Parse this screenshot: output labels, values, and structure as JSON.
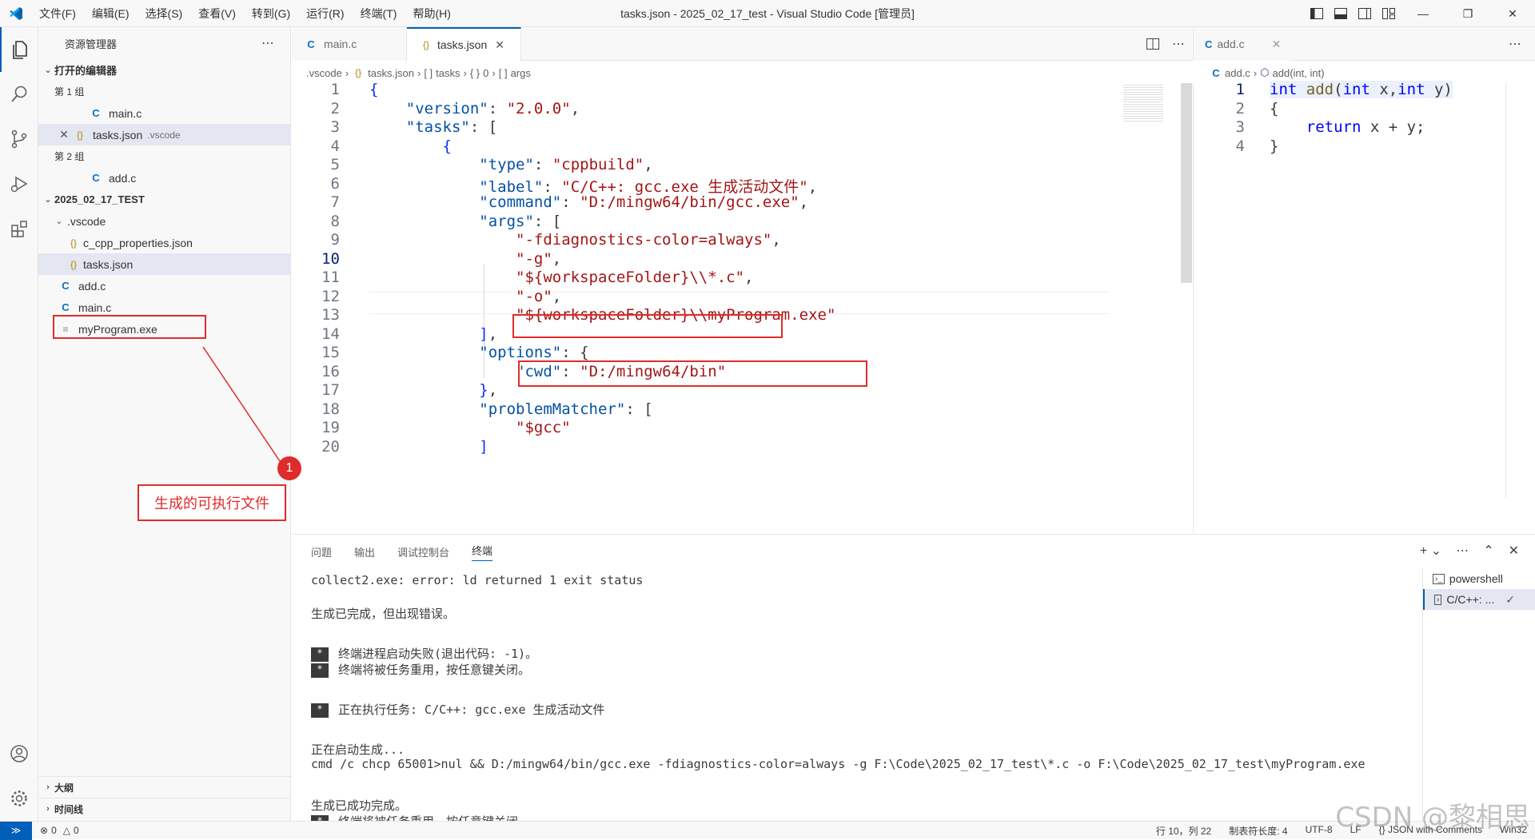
{
  "titlebar": {
    "menus": [
      "文件(F)",
      "编辑(E)",
      "选择(S)",
      "查看(V)",
      "转到(G)",
      "运行(R)",
      "终端(T)",
      "帮助(H)"
    ],
    "title": "tasks.json - 2025_02_17_test - Visual Studio Code [管理员]"
  },
  "sidebar": {
    "title": "资源管理器",
    "open_editors": "打开的编辑器",
    "group1": "第 1 组",
    "group1_files": [
      "main.c",
      "tasks.json"
    ],
    "group1_dir": ".vscode",
    "group2": "第 2 组",
    "group2_files": [
      "add.c"
    ],
    "workspace": "2025_02_17_TEST",
    "vscode_dir": ".vscode",
    "vscode_files": [
      "c_cpp_properties.json",
      "tasks.json"
    ],
    "root_files": [
      "add.c",
      "main.c",
      "myProgram.exe"
    ],
    "outline": "大纲",
    "timeline": "时间线"
  },
  "annotation": {
    "badge": "1",
    "label": "生成的可执行文件"
  },
  "editor1": {
    "tabs": [
      "main.c",
      "tasks.json"
    ],
    "crumbs": [
      ".vscode",
      "tasks.json",
      "tasks",
      "0",
      "args"
    ],
    "line_numbers": [
      "1",
      "2",
      "3",
      "4",
      "5",
      "6",
      "7",
      "8",
      "9",
      "10",
      "11",
      "12",
      "13",
      "14",
      "15",
      "16",
      "17",
      "18",
      "19",
      "20"
    ],
    "lines": [
      "{",
      "    \"version\": \"2.0.0\",",
      "    \"tasks\": [",
      "        {",
      "            \"type\": \"cppbuild\",",
      "            \"label\": \"C/C++: gcc.exe 生成活动文件\",",
      "            \"command\": \"D:/mingw64/bin/gcc.exe\",",
      "            \"args\": [",
      "                \"-fdiagnostics-color=always\",",
      "                \"-g\",",
      "                \"${workspaceFolder}\\\\*.c\",",
      "                \"-o\",",
      "                \"${workspaceFolder}\\\\myProgram.exe\"",
      "            ],",
      "            \"options\": {",
      "                \"cwd\": \"D:/mingw64/bin\"",
      "            },",
      "            \"problemMatcher\": [",
      "                \"$gcc\"",
      "            ]"
    ]
  },
  "editor2": {
    "tab": "add.c",
    "crumbs": [
      "add.c",
      "add(int, int)"
    ],
    "line_numbers": [
      "1",
      "2",
      "3",
      "4"
    ],
    "lines": [
      "int add(int x,int y)",
      "{",
      "    return x + y;",
      "}"
    ]
  },
  "panel": {
    "tabs": [
      "问题",
      "输出",
      "调试控制台",
      "终端"
    ],
    "terminal_lines": [
      "collect2.exe: error: ld returned 1 exit status",
      "",
      "生成已完成，但出现错误。",
      "",
      "终端进程启动失败(退出代码: -1)。",
      "终端将被任务重用，按任意键关闭。",
      "",
      "正在执行任务: C/C++: gcc.exe 生成活动文件",
      "",
      "正在启动生成...",
      "cmd /c chcp 65001>nul && D:/mingw64/bin/gcc.exe -fdiagnostics-color=always -g F:\\Code\\2025_02_17_test\\*.c -o F:\\Code\\2025_02_17_test\\myProgram.exe",
      "",
      "生成已成功完成。",
      "终端将被任务重用，按任意键关闭。"
    ],
    "terminals": [
      "powershell",
      "C/C++: ..."
    ]
  },
  "status": {
    "errors": "0",
    "warnings": "0",
    "position": "行 10，列 22",
    "tab_size": "制表符长度: 4",
    "encoding": "UTF-8",
    "eol": "LF",
    "language": "JSON with Comments",
    "platform": "Win32"
  },
  "watermark": "CSDN @黎相思",
  "colors": {
    "accent": "#005fb8",
    "annotation": "#e02b2b"
  }
}
